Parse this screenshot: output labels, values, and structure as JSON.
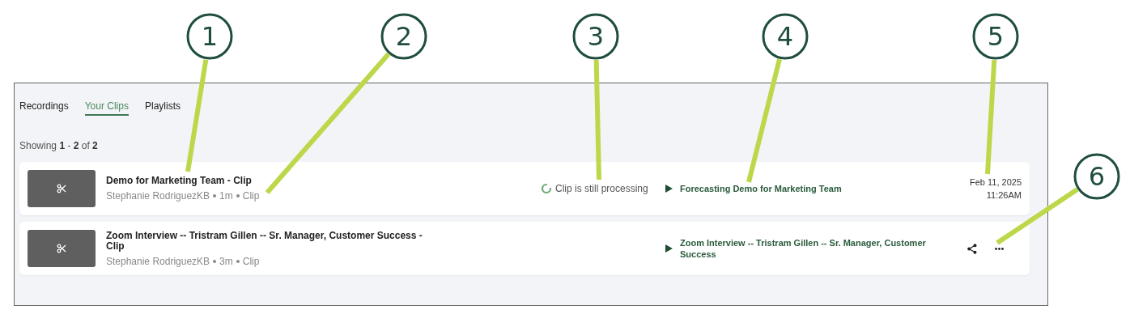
{
  "callouts": [
    {
      "number": "1"
    },
    {
      "number": "2"
    },
    {
      "number": "3"
    },
    {
      "number": "4"
    },
    {
      "number": "5"
    },
    {
      "number": "6"
    }
  ],
  "tabs": [
    {
      "label": "Recordings",
      "selected": false
    },
    {
      "label": "Your Clips",
      "selected": true
    },
    {
      "label": "Playlists",
      "selected": false
    }
  ],
  "showing": "Showing **1** - **2** of **2**",
  "clips": [
    {
      "title": "Demo for Marketing Team - Clip",
      "author": "Stephanie RodriguezKB",
      "duration": "1m",
      "type": "Clip",
      "processing": true,
      "status": "Clip is still processing",
      "source": "Forecasting Demo for Marketing Team",
      "date": "Feb 11, 2025",
      "time": "11:26AM",
      "actions": false
    },
    {
      "title": "Zoom Interview -- Tristram Gillen -- Sr. Manager, Customer Success - Clip",
      "author": "Stephanie RodriguezKB",
      "duration": "3m",
      "type": "Clip",
      "processing": false,
      "source": "Zoom Interview -- Tristram Gillen -- Sr. Manager, Customer Success",
      "actions": true
    }
  ]
}
